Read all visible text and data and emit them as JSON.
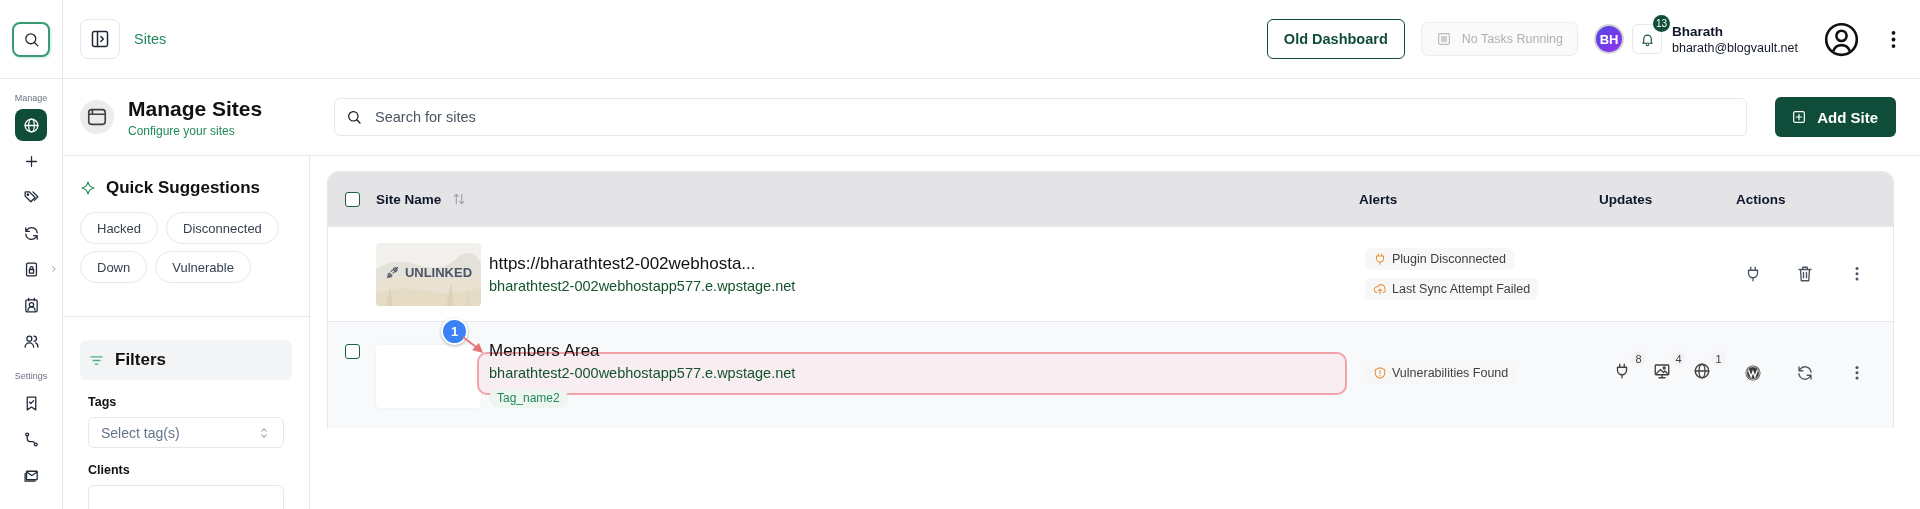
{
  "rail": {
    "sections": [
      {
        "label": "Manage",
        "items": [
          {
            "selected": true,
            "has_submenu": false
          },
          {
            "selected": false,
            "has_submenu": false
          },
          {
            "selected": false,
            "has_submenu": false
          },
          {
            "selected": false,
            "has_submenu": false
          },
          {
            "selected": false,
            "has_submenu": true
          },
          {
            "selected": false,
            "has_submenu": false
          },
          {
            "selected": false,
            "has_submenu": false
          }
        ]
      },
      {
        "label": "Settings",
        "items": [
          {
            "selected": false,
            "has_submenu": false
          },
          {
            "selected": false,
            "has_submenu": false
          },
          {
            "selected": false,
            "has_submenu": false
          }
        ]
      }
    ]
  },
  "header": {
    "breadcrumb": "Sites",
    "old_dashboard": "Old Dashboard",
    "tasks": {
      "label": "No Tasks Running",
      "disabled": true
    },
    "avatar_initials": "BH",
    "notifications_count": "13",
    "user": {
      "name": "Bharath",
      "email": "bharath@blogvault.net"
    }
  },
  "page": {
    "title": "Manage Sites",
    "subtitle": "Configure your sites",
    "search": {
      "placeholder": "Search for sites"
    },
    "add_button": "Add Site"
  },
  "quick_suggestions": {
    "title": "Quick Suggestions",
    "chips": [
      "Hacked",
      "Disconnected",
      "Down",
      "Vulnerable"
    ]
  },
  "filters": {
    "title": "Filters",
    "fields": [
      {
        "label": "Tags",
        "placeholder": "Select tag(s)"
      },
      {
        "label": "Clients"
      }
    ]
  },
  "table": {
    "select_all": {
      "checked": false
    },
    "columns": [
      "Site Name",
      "Alerts",
      "Updates",
      "Actions"
    ],
    "rows": [
      {
        "kind": "unlinked",
        "thumbnail_label": "UNLINKED",
        "title": "https://bharathtest2-002webhosta...",
        "url": "bharathtest2-002webhostapp577.e.wpstage.net",
        "alerts": [
          {
            "kind": "plugin",
            "text": "Plugin Disconnected"
          },
          {
            "kind": "sync",
            "text": "Last Sync Attempt Failed"
          }
        ]
      },
      {
        "kind": "linked",
        "checked": false,
        "annotation": "1",
        "title": "Members Area",
        "url": "bharathtest2-000webhostapp577.e.wpstage.net",
        "tags": [
          "Tag_name2"
        ],
        "alerts": [
          {
            "kind": "vulnerability",
            "text": "Vulnerabilities Found"
          }
        ],
        "updates": [
          {
            "kind": "plugins",
            "count": "8"
          },
          {
            "kind": "themes",
            "count": "4"
          },
          {
            "kind": "core",
            "count": "1"
          }
        ]
      }
    ]
  }
}
